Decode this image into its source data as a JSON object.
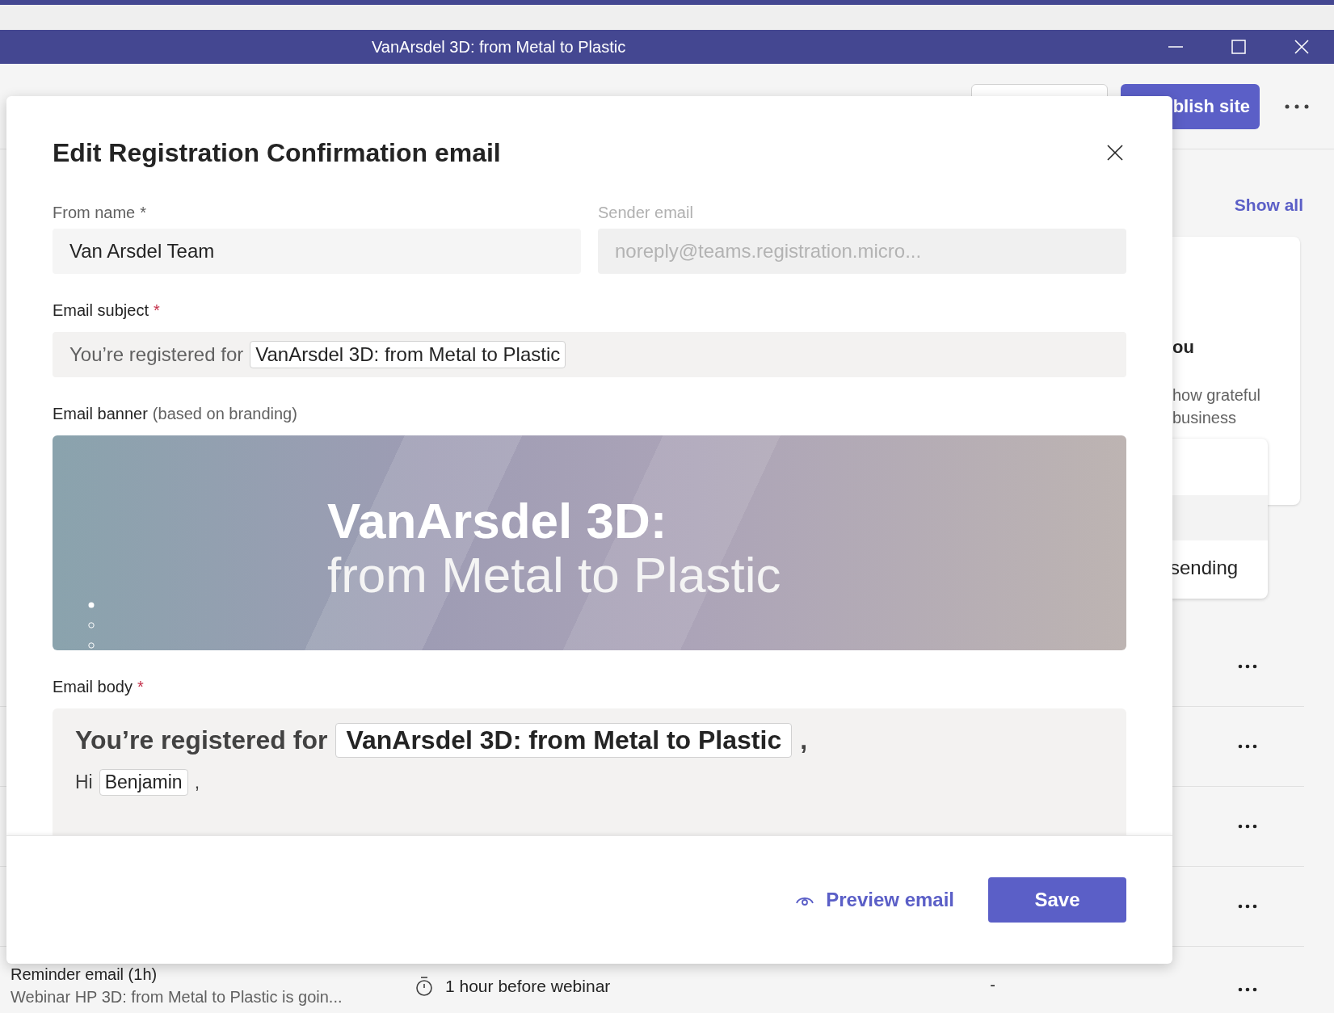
{
  "window": {
    "title": "VanArsdel 3D: from Metal to Plastic"
  },
  "background": {
    "header": {
      "partial_button": "blish site"
    },
    "show_all": "Show all",
    "card": {
      "title_fragment": "ou",
      "text_lines": [
        "how grateful",
        "business"
      ]
    },
    "inner_card": {
      "text_fragment": "sending"
    },
    "reminder_row": {
      "name": "Reminder email (1h)",
      "preview": "Webinar HP 3D: from Metal to Plastic is goin...",
      "timing": "1 hour before webinar",
      "column_3": "-"
    }
  },
  "dialog": {
    "title": "Edit Registration Confirmation email",
    "fields": [
      {
        "label": "From name",
        "required_mark": "*",
        "value": "Van Arsdel Team",
        "disabled": false
      },
      {
        "label": "Sender email",
        "value": "noreply@teams.registration.micro...",
        "disabled": true
      }
    ],
    "subject": {
      "label": "Email subject",
      "required_mark": "*",
      "prefix": "You’re registered for",
      "token": "VanArsdel 3D: from Metal to Plastic"
    },
    "banner": {
      "label": "Email banner",
      "hint": "(based on branding)",
      "title": "VanArsdel 3D:",
      "subtitle": "from Metal to Plastic"
    },
    "body": {
      "label": "Email body",
      "required_mark": "*",
      "heading_prefix": "You’re registered for",
      "heading_token": "VanArsdel 3D: from Metal to Plastic",
      "heading_suffix": ",",
      "greeting": "Hi",
      "name_token": "Benjamin",
      "greeting_suffix": ","
    },
    "actions": {
      "preview": "Preview email",
      "save": "Save"
    }
  }
}
